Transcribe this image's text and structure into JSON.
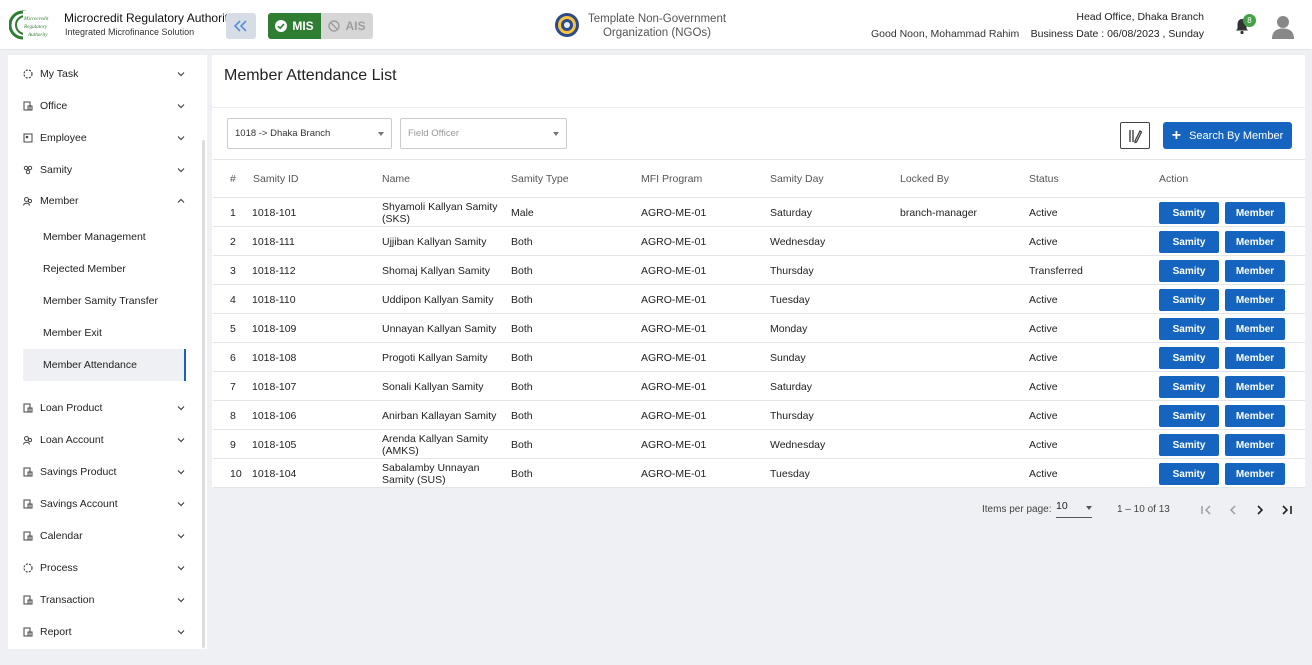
{
  "header": {
    "logo_text": [
      "Microcredit",
      "Regulatory",
      "Authority"
    ],
    "brand_title": "Microcredit Regulatory Authority",
    "brand_subtitle": "Integrated Microfinance Solution",
    "mis_label": "MIS",
    "ais_label": "AIS",
    "org_line1": "Template Non-Government",
    "org_line2": "Organization (NGOs)",
    "greeting": "Good Noon, Mohammad Rahim",
    "office": "Head Office, Dhaka Branch",
    "business_date": "Business Date : 06/08/2023 , Sunday",
    "notification_count": "8",
    "accent_color": "#2e7d32",
    "primary_color": "#1565c0"
  },
  "sidebar": {
    "items": [
      {
        "label": "My Task",
        "icon": "task-icon"
      },
      {
        "label": "Office",
        "icon": "office-icon"
      },
      {
        "label": "Employee",
        "icon": "employee-icon"
      },
      {
        "label": "Samity",
        "icon": "samity-icon"
      },
      {
        "label": "Member",
        "icon": "member-icon",
        "expanded": true
      }
    ],
    "member_sub": [
      {
        "label": "Member Management"
      },
      {
        "label": "Rejected Member"
      },
      {
        "label": "Member Samity Transfer"
      },
      {
        "label": "Member Exit"
      },
      {
        "label": "Member Attendance",
        "active": true
      }
    ],
    "items_after": [
      {
        "label": "Loan Product"
      },
      {
        "label": "Loan Account"
      },
      {
        "label": "Savings Product"
      },
      {
        "label": "Savings Account"
      },
      {
        "label": "Calendar"
      },
      {
        "label": "Process"
      },
      {
        "label": "Transaction"
      },
      {
        "label": "Report"
      }
    ]
  },
  "main": {
    "title": "Member Attendance List",
    "branch_select": "1018 -> Dhaka Branch",
    "officer_placeholder": "Field Officer",
    "search_button": "Search By Member",
    "columns": [
      "#",
      "Samity ID",
      "Name",
      "Samity Type",
      "MFI Program",
      "Samity Day",
      "Locked By",
      "Status",
      "Action"
    ],
    "rows": [
      {
        "idx": "1",
        "id": "1018-101",
        "name": "Shyamoli Kallyan Samity (SKS)",
        "type": "Male",
        "program": "AGRO-ME-01",
        "day": "Saturday",
        "locked": "branch-manager",
        "status": "Active"
      },
      {
        "idx": "2",
        "id": "1018-111",
        "name": "Ujjiban Kallyan Samity",
        "type": "Both",
        "program": "AGRO-ME-01",
        "day": "Wednesday",
        "locked": "",
        "status": "Active"
      },
      {
        "idx": "3",
        "id": "1018-112",
        "name": "Shomaj Kallyan Samity",
        "type": "Both",
        "program": "AGRO-ME-01",
        "day": "Thursday",
        "locked": "",
        "status": "Transferred"
      },
      {
        "idx": "4",
        "id": "1018-110",
        "name": "Uddipon Kallyan Samity",
        "type": "Both",
        "program": "AGRO-ME-01",
        "day": "Tuesday",
        "locked": "",
        "status": "Active"
      },
      {
        "idx": "5",
        "id": "1018-109",
        "name": "Unnayan Kallyan Samity",
        "type": "Both",
        "program": "AGRO-ME-01",
        "day": "Monday",
        "locked": "",
        "status": "Active"
      },
      {
        "idx": "6",
        "id": "1018-108",
        "name": "Progoti Kallyan Samity",
        "type": "Both",
        "program": "AGRO-ME-01",
        "day": "Sunday",
        "locked": "",
        "status": "Active"
      },
      {
        "idx": "7",
        "id": "1018-107",
        "name": "Sonali Kallyan Samity",
        "type": "Both",
        "program": "AGRO-ME-01",
        "day": "Saturday",
        "locked": "",
        "status": "Active"
      },
      {
        "idx": "8",
        "id": "1018-106",
        "name": "Anirban Kallayan Samity",
        "type": "Both",
        "program": "AGRO-ME-01",
        "day": "Thursday",
        "locked": "",
        "status": "Active"
      },
      {
        "idx": "9",
        "id": "1018-105",
        "name": "Arenda Kallyan Samity (AMKS)",
        "type": "Both",
        "program": "AGRO-ME-01",
        "day": "Wednesday",
        "locked": "",
        "status": "Active"
      },
      {
        "idx": "10",
        "id": "1018-104",
        "name": "Sabalamby Unnayan Samity (SUS)",
        "type": "Both",
        "program": "AGRO-ME-01",
        "day": "Tuesday",
        "locked": "",
        "status": "Active"
      }
    ],
    "action_samity": "Samity",
    "action_member": "Member",
    "pager": {
      "items_label": "Items per page:",
      "page_size": "10",
      "range": "1 – 10 of 13"
    }
  }
}
